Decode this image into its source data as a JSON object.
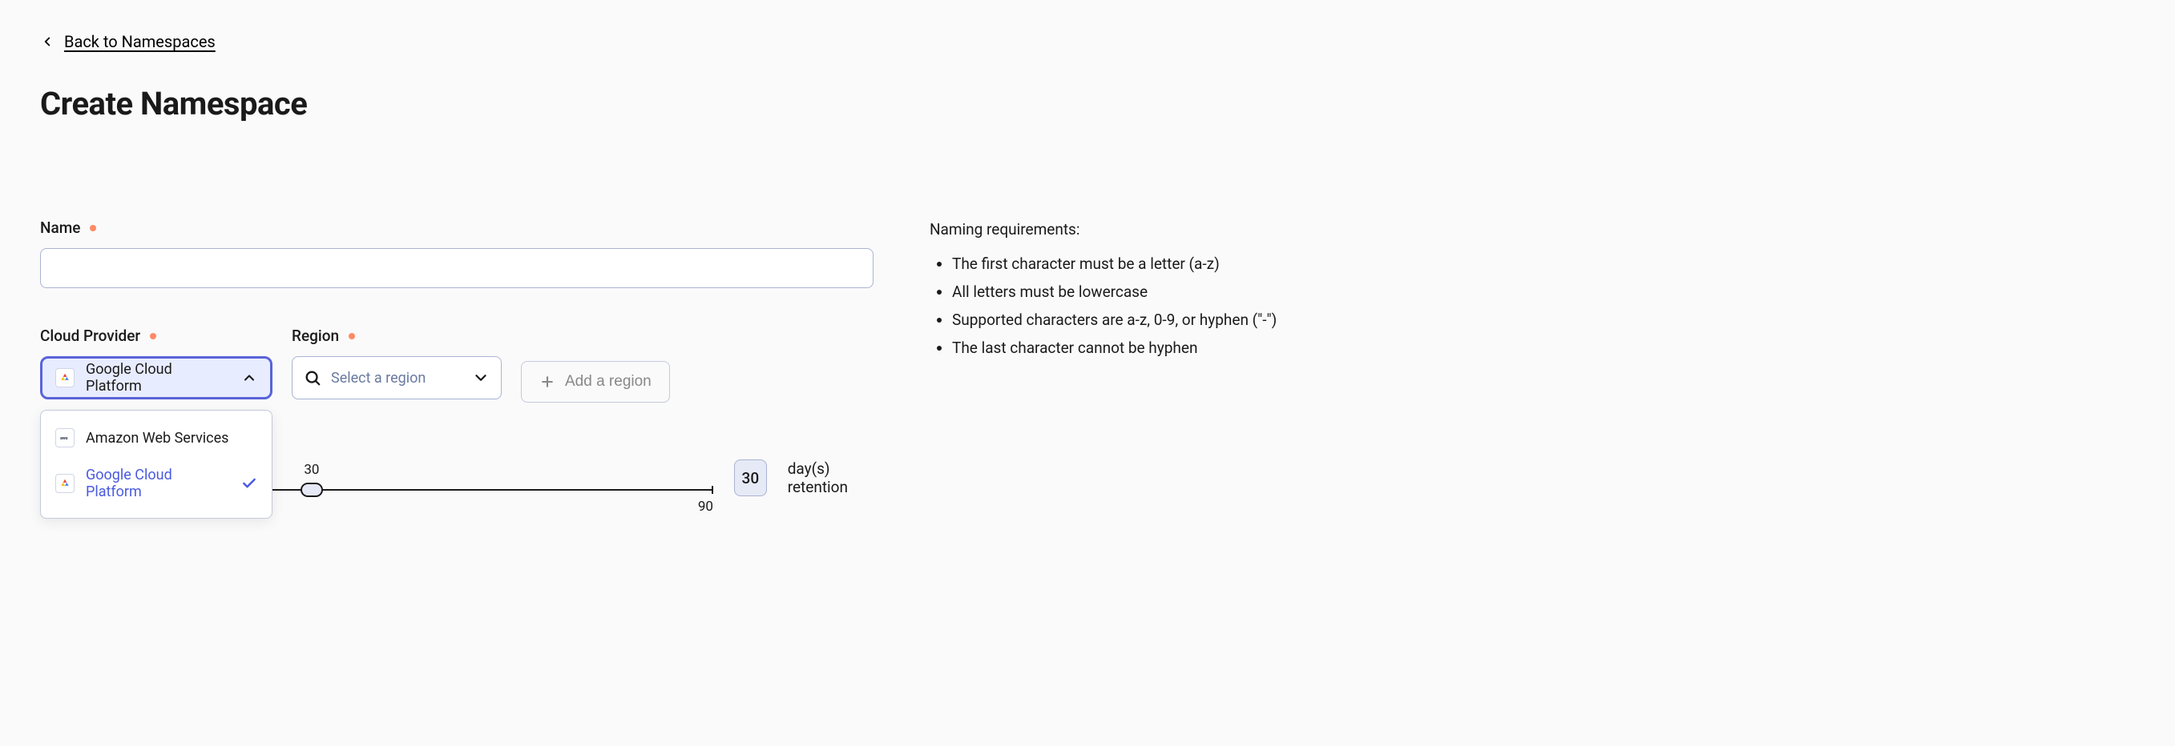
{
  "back": {
    "label": "Back to Namespaces"
  },
  "title": "Create Namespace",
  "name_field": {
    "label": "Name",
    "value": ""
  },
  "provider_field": {
    "label": "Cloud Provider",
    "selected": "Google Cloud Platform",
    "options": [
      {
        "id": "aws",
        "label": "Amazon Web Services",
        "selected": false
      },
      {
        "id": "gcp",
        "label": "Google Cloud Platform",
        "selected": true
      }
    ]
  },
  "region_field": {
    "label": "Region",
    "placeholder": "Select a region"
  },
  "add_region": {
    "label": "Add a region"
  },
  "naming": {
    "title": "Naming requirements:",
    "rules": [
      "The first character must be a letter (a-z)",
      "All letters must be lowercase",
      "Supported characters are a-z, 0-9, or hyphen (\"-\")",
      "The last character cannot be hyphen"
    ]
  },
  "retention": {
    "value": 30,
    "min": 1,
    "max": 90,
    "unit": "day(s) retention"
  }
}
